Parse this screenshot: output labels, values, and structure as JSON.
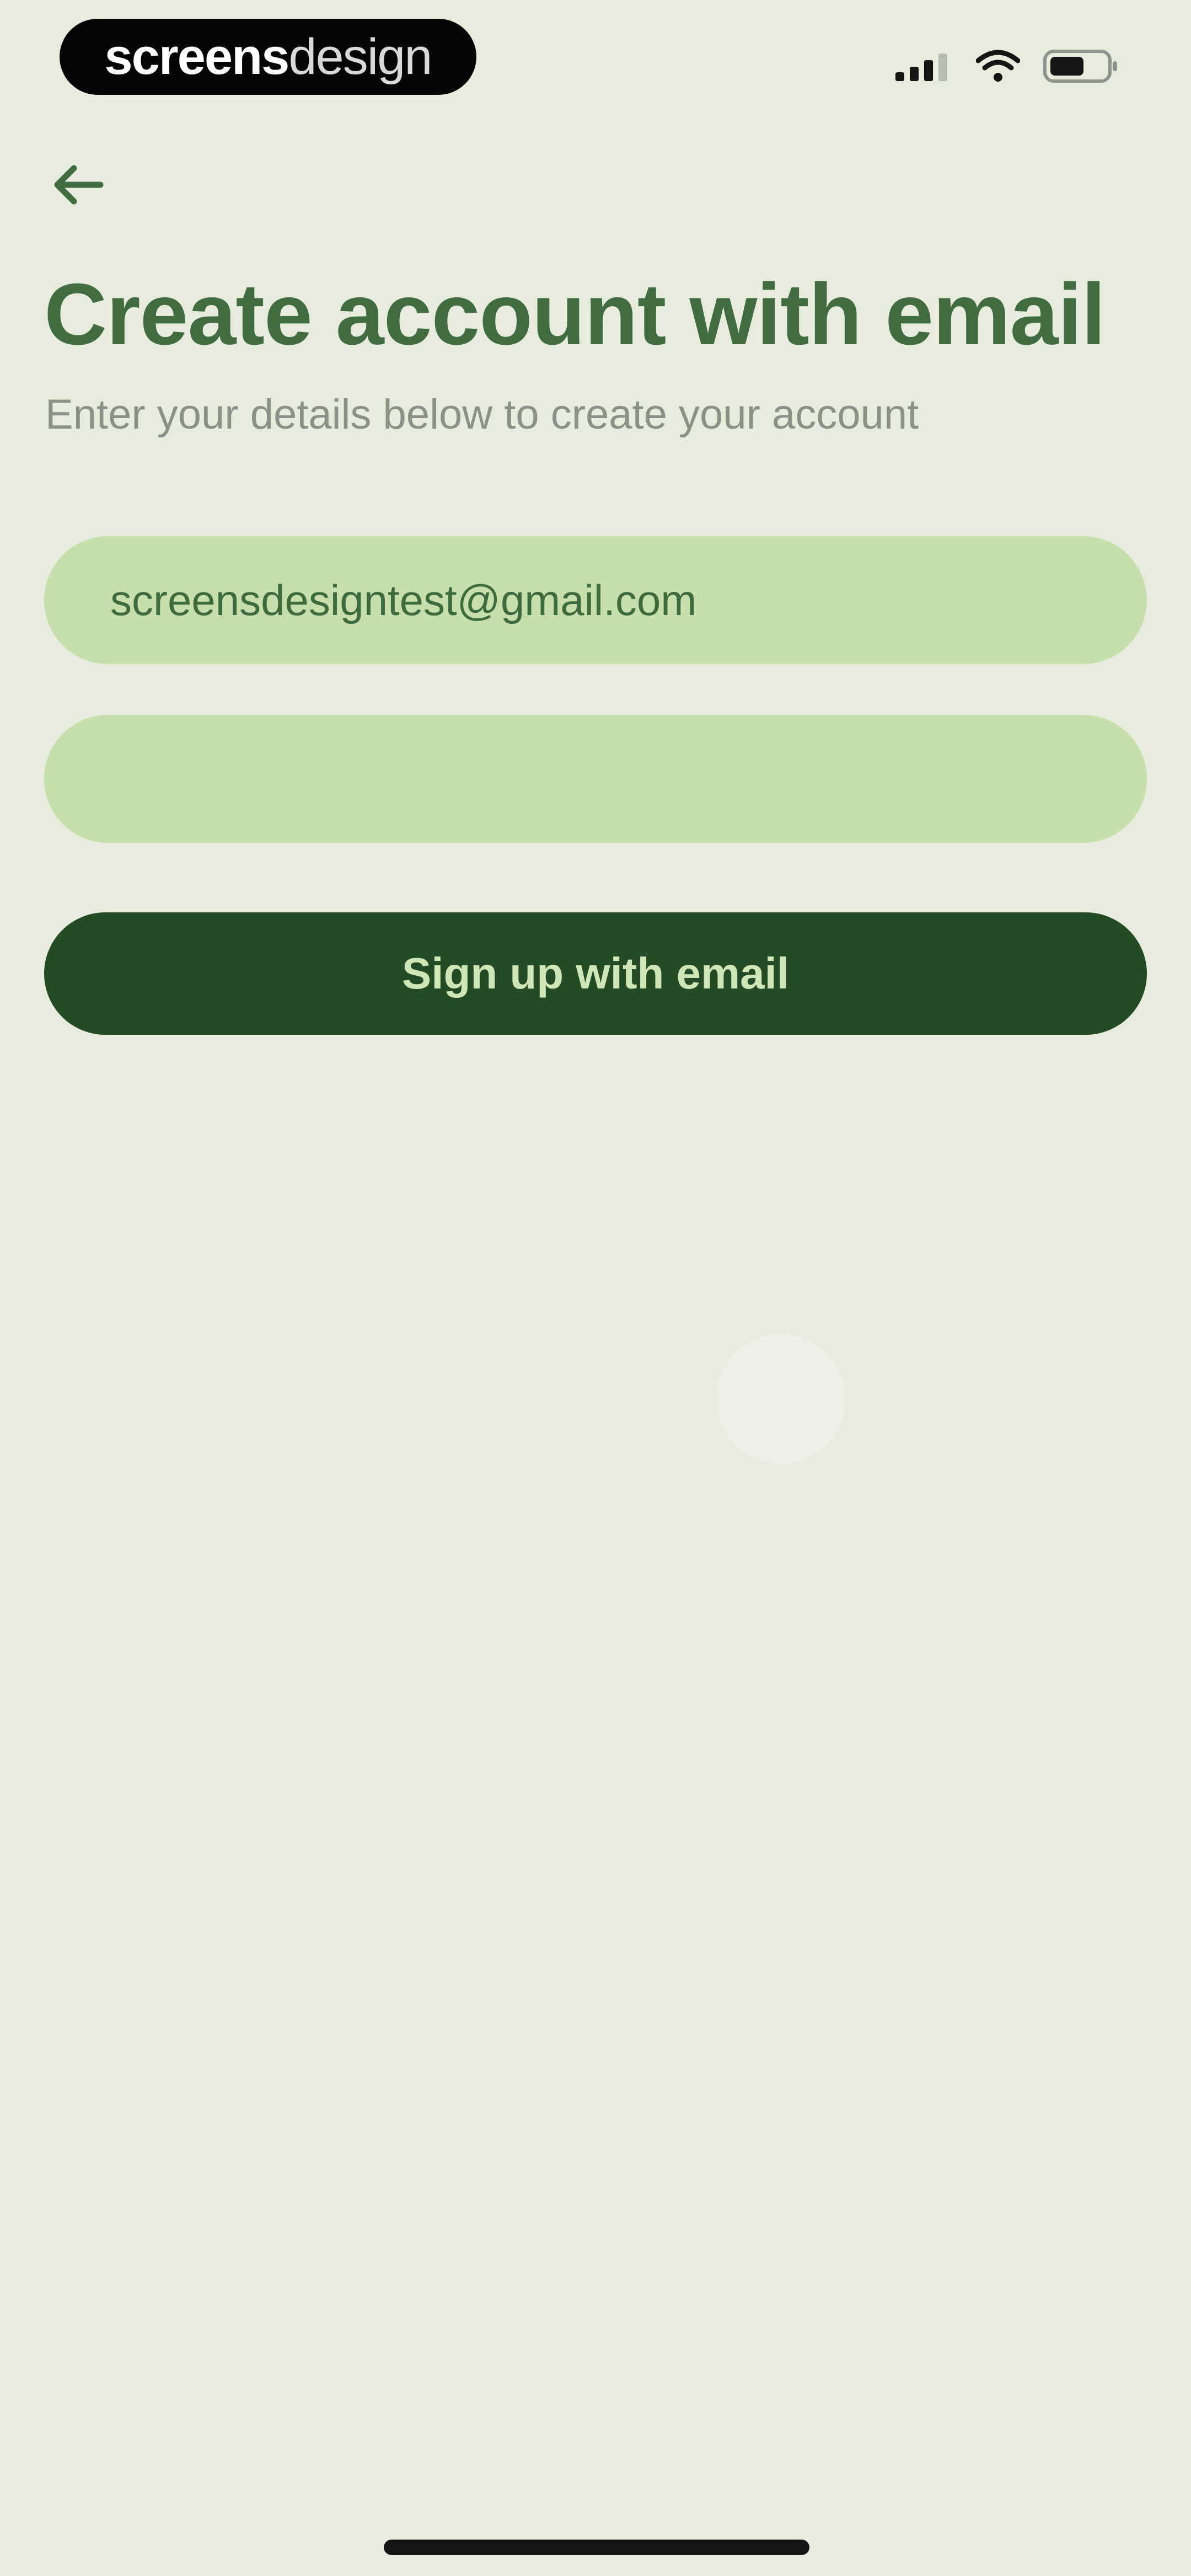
{
  "status_bar": {
    "brand_strong": "screens",
    "brand_light": "design",
    "icons": [
      "signal-icon",
      "wifi-icon",
      "battery-icon"
    ]
  },
  "header": {
    "back_icon": "arrow-left-icon"
  },
  "title": "Create account with email",
  "subtitle": "Enter your details below to create your account",
  "form": {
    "email_value": "screensdesigntest@gmail.com",
    "password_value": ""
  },
  "signup": {
    "label": "Sign up with email"
  },
  "colors": {
    "background": "#e8ecdd",
    "title": "#416c42",
    "field": "#c6dfac",
    "button": "#244a26",
    "button_text": "#cfe6b6"
  }
}
